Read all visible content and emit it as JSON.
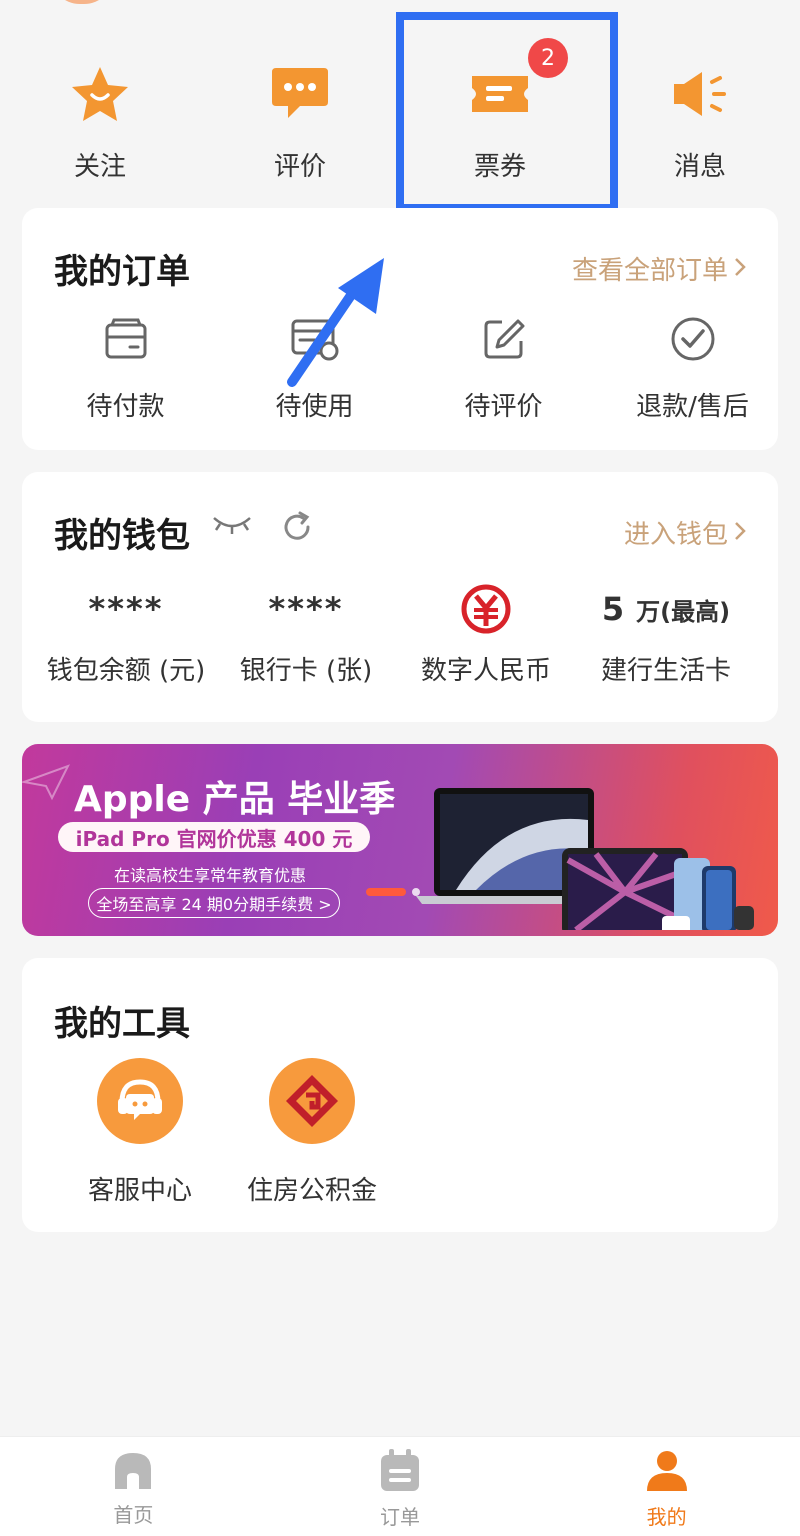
{
  "quick_actions": [
    {
      "label": "关注",
      "icon": "star-icon"
    },
    {
      "label": "评价",
      "icon": "chat-icon"
    },
    {
      "label": "票券",
      "icon": "ticket-icon",
      "badge": "2"
    },
    {
      "label": "消息",
      "icon": "speaker-icon"
    }
  ],
  "orders": {
    "title": "我的订单",
    "link": "查看全部订单",
    "items": [
      {
        "label": "待付款",
        "icon": "wallet-icon"
      },
      {
        "label": "待使用",
        "icon": "receipt-icon"
      },
      {
        "label": "待评价",
        "icon": "edit-icon"
      },
      {
        "label": "退款/售后",
        "icon": "check-circle-icon"
      }
    ]
  },
  "wallet": {
    "title": "我的钱包",
    "link": "进入钱包",
    "items": [
      {
        "value": "****",
        "label": "钱包余额 (元)"
      },
      {
        "value": "****",
        "label": "银行卡 (张)"
      },
      {
        "value": "",
        "label": "数字人民币"
      },
      {
        "value": "5",
        "unit": "万(最高)",
        "label": "建行生活卡"
      }
    ]
  },
  "banner": {
    "title": "Apple 产品 毕业季",
    "pill": "iPad Pro 官网价优惠 400 元",
    "sub": "在读高校生享常年教育优惠",
    "outline": "全场至高享 24 期0分期手续费 >"
  },
  "tools": {
    "title": "我的工具",
    "items": [
      {
        "label": "客服中心",
        "icon": "headset-icon"
      },
      {
        "label": "住房公积金",
        "icon": "housing-fund-icon"
      }
    ]
  },
  "tabbar": [
    {
      "label": "首页",
      "icon": "home-icon",
      "active": false
    },
    {
      "label": "订单",
      "icon": "order-icon",
      "active": false
    },
    {
      "label": "我的",
      "icon": "user-icon",
      "active": true
    }
  ],
  "colors": {
    "accent": "#f07a1a",
    "link": "#c9a27a",
    "badge": "#f04848",
    "highlight": "#2f6ef2"
  }
}
